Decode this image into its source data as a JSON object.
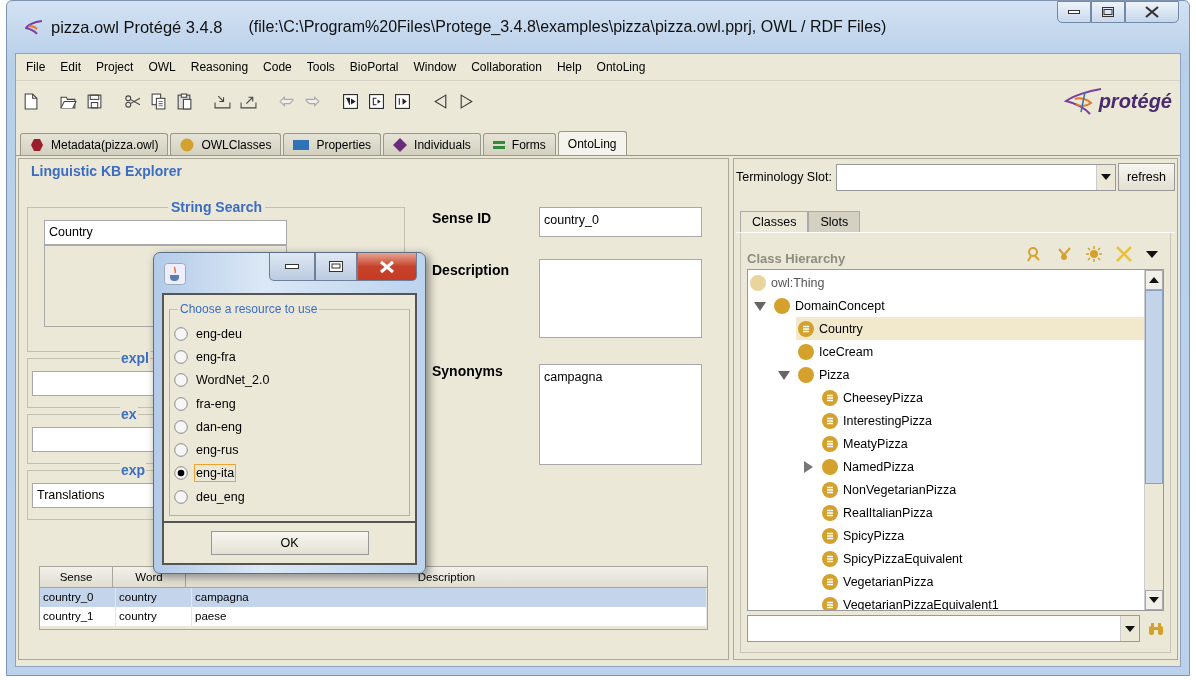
{
  "window": {
    "title": "pizza.owl  Protégé 3.4.8",
    "path": "(file:\\C:\\Program%20Files\\Protege_3.4.8\\examples\\pizza\\pizza.owl.pprj, OWL / RDF Files)"
  },
  "menu": [
    "File",
    "Edit",
    "Project",
    "OWL",
    "Reasoning",
    "Code",
    "Tools",
    "BioPortal",
    "Window",
    "Collaboration",
    "Help",
    "OntoLing"
  ],
  "logo": "protégé",
  "tabs": [
    {
      "label": "Metadata(pizza.owl)",
      "selected": false
    },
    {
      "label": "OWLClasses",
      "selected": false
    },
    {
      "label": "Properties",
      "selected": false
    },
    {
      "label": "Individuals",
      "selected": false
    },
    {
      "label": "Forms",
      "selected": false
    },
    {
      "label": "OntoLing",
      "selected": true
    }
  ],
  "explorer": {
    "title": "Linguistic KB Explorer",
    "string_search": {
      "title": "String Search",
      "value": "Country"
    },
    "panels": [
      {
        "title": "expl"
      },
      {
        "title": "ex"
      },
      {
        "title": "exp",
        "value": "Translations"
      }
    ],
    "fields": [
      {
        "label": "Sense ID",
        "kind": "line",
        "value": "country_0"
      },
      {
        "label": "Description",
        "kind": "area"
      },
      {
        "label": "Synonyms",
        "kind": "area",
        "value": "campagna"
      }
    ],
    "table": {
      "columns": [
        "Sense",
        "Word",
        "Description"
      ],
      "rows": [
        {
          "cells": [
            "country_0",
            "country",
            "campagna"
          ],
          "selected": true
        },
        {
          "cells": [
            "country_1",
            "country",
            "paese"
          ],
          "selected": false
        }
      ]
    }
  },
  "dialog": {
    "group": "Choose a resource to use",
    "options": [
      {
        "label": "eng-deu",
        "selected": false,
        "focused": false
      },
      {
        "label": "eng-fra",
        "selected": false,
        "focused": false
      },
      {
        "label": "WordNet_2.0",
        "selected": false,
        "focused": false
      },
      {
        "label": "fra-eng",
        "selected": false,
        "focused": false
      },
      {
        "label": "dan-eng",
        "selected": false,
        "focused": false
      },
      {
        "label": "eng-rus",
        "selected": false,
        "focused": false
      },
      {
        "label": "eng-ita",
        "selected": true,
        "focused": true
      },
      {
        "label": "deu_eng",
        "selected": false,
        "focused": false
      }
    ],
    "button": "OK"
  },
  "browser": {
    "slot_label": "Terminology Slot:",
    "refresh": "refresh",
    "tabs": [
      {
        "label": "Classes",
        "selected": true
      },
      {
        "label": "Slots",
        "selected": false
      }
    ],
    "hierarchy_title": "Class Hierarchy",
    "tree": [
      {
        "label": "owl:Thing",
        "kind": "thing",
        "selected": false,
        "children": [
          {
            "label": "DomainConcept",
            "kind": "primitive",
            "selected": false,
            "expanded": true,
            "children": [
              {
                "label": "Country",
                "kind": "defined",
                "selected": true
              },
              {
                "label": "IceCream",
                "kind": "primitive",
                "selected": false
              },
              {
                "label": "Pizza",
                "kind": "primitive",
                "selected": false,
                "expanded": true,
                "children": [
                  {
                    "label": "CheeseyPizza",
                    "kind": "defined",
                    "selected": false
                  },
                  {
                    "label": "InterestingPizza",
                    "kind": "defined",
                    "selected": false
                  },
                  {
                    "label": "MeatyPizza",
                    "kind": "defined",
                    "selected": false
                  },
                  {
                    "label": "NamedPizza",
                    "kind": "primitive",
                    "selected": false,
                    "expanded": false
                  },
                  {
                    "label": "NonVegetarianPizza",
                    "kind": "defined",
                    "selected": false
                  },
                  {
                    "label": "RealItalianPizza",
                    "kind": "defined",
                    "selected": false
                  },
                  {
                    "label": "SpicyPizza",
                    "kind": "defined",
                    "selected": false
                  },
                  {
                    "label": "SpicyPizzaEquivalent",
                    "kind": "defined",
                    "selected": false
                  },
                  {
                    "label": "VegetarianPizza",
                    "kind": "defined",
                    "selected": false
                  },
                  {
                    "label": "VegetarianPizzaEquivalent1",
                    "kind": "defined",
                    "selected": false
                  }
                ]
              }
            ]
          }
        ]
      }
    ]
  }
}
